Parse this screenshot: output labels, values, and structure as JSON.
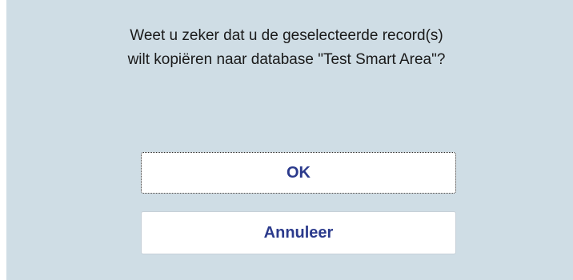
{
  "dialog": {
    "message_line1": "Weet u zeker dat u de geselecteerde record(s)",
    "message_line2": "wilt kopiëren naar database \"Test Smart Area\"?",
    "ok_label": "OK",
    "cancel_label": "Annuleer"
  },
  "colors": {
    "background": "#cfdde5",
    "button_text": "#2b3a8c"
  }
}
